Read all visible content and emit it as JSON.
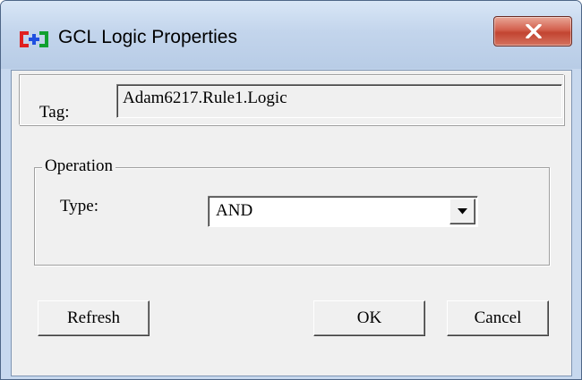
{
  "window": {
    "title": "GCL Logic Properties",
    "icon": "gcl-logic-icon",
    "close_icon": "close-x-icon"
  },
  "tag": {
    "label": "Tag:",
    "value": "Adam6217.Rule1.Logic"
  },
  "operation": {
    "legend": "Operation",
    "type_label": "Type:",
    "type_value": "AND",
    "dropdown_icon": "chevron-down-icon"
  },
  "buttons": {
    "refresh": "Refresh",
    "ok": "OK",
    "cancel": "Cancel"
  },
  "colors": {
    "close_button": "#c9503d",
    "icon_red": "#e02020",
    "icon_blue": "#2050e0",
    "icon_green": "#10a030",
    "titlebar": "#c3d5ec"
  }
}
